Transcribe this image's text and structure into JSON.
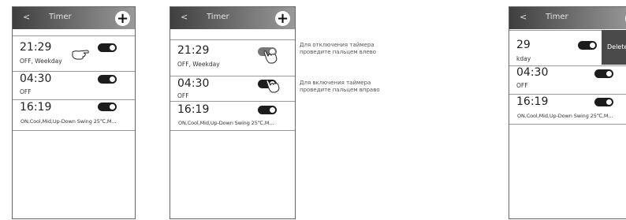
{
  "icons": {
    "back": "chevron-left-icon",
    "add": "plus-icon",
    "toggle": "toggle-switch-icon",
    "hand": "pointing-hand-icon"
  },
  "screens": [
    {
      "header": {
        "back_label": "<",
        "title": "Timer",
        "add_label": "+"
      },
      "timers": [
        {
          "time": "21:29",
          "detail": "OFF, Weekday",
          "toggle_on": true
        },
        {
          "time": "04:30",
          "detail": "OFF",
          "toggle_on": true
        },
        {
          "time": "16:19",
          "detail": "ON,Cool,Mid,Up-Down Swing 25℃,M...",
          "toggle_on": true
        }
      ]
    },
    {
      "header": {
        "back_label": "<",
        "title": "Timer",
        "add_label": "+"
      },
      "timers": [
        {
          "time": "21:29",
          "detail": "OFF, Weekday",
          "toggle_on": false
        },
        {
          "time": "04:30",
          "detail": "OFF",
          "toggle_on": true
        },
        {
          "time": "16:19",
          "detail": "ON,Cool,Mid,Up-Down Swing 25℃,M...",
          "toggle_on": true
        }
      ]
    },
    {
      "header": {
        "back_label": "<",
        "title": "Timer",
        "add_label": "+"
      },
      "timers": [
        {
          "time": "29",
          "detail": "kday",
          "toggle_on": true
        },
        {
          "time": "04:30",
          "detail": "OFF",
          "toggle_on": true
        },
        {
          "time": "16:19",
          "detail": "ON,Cool,Mid,Up-Down Swing 25℃,M...",
          "toggle_on": true
        }
      ],
      "delete_label": "Delete"
    }
  ],
  "instructions": {
    "disable_line1": "Для отключения таймера",
    "disable_line2": "проведите пальцем влево",
    "enable_line1": "Для включения таймера",
    "enable_line2": "проведите пальцем вправо"
  }
}
